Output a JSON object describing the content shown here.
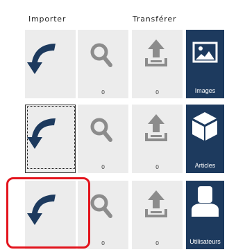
{
  "headers": {
    "import": "Importer",
    "transfer": "Transférer"
  },
  "rows": [
    {
      "category": "Images",
      "search_count": "0",
      "upload_count": "0"
    },
    {
      "category": "Articles",
      "search_count": "0",
      "upload_count": "0"
    },
    {
      "category": "Utilisateurs",
      "search_count": "0",
      "upload_count": "0"
    }
  ],
  "colors": {
    "accent": "#1d3a5e",
    "tile_bg": "#ececec",
    "icon_gray": "#8c8c8c",
    "highlight": "#e3141d"
  },
  "icons": {
    "import": "curved-arrow-back-icon",
    "search": "magnifier-icon",
    "upload": "upload-tray-icon",
    "images": "picture-icon",
    "articles": "box-icon",
    "users": "user-icon"
  }
}
